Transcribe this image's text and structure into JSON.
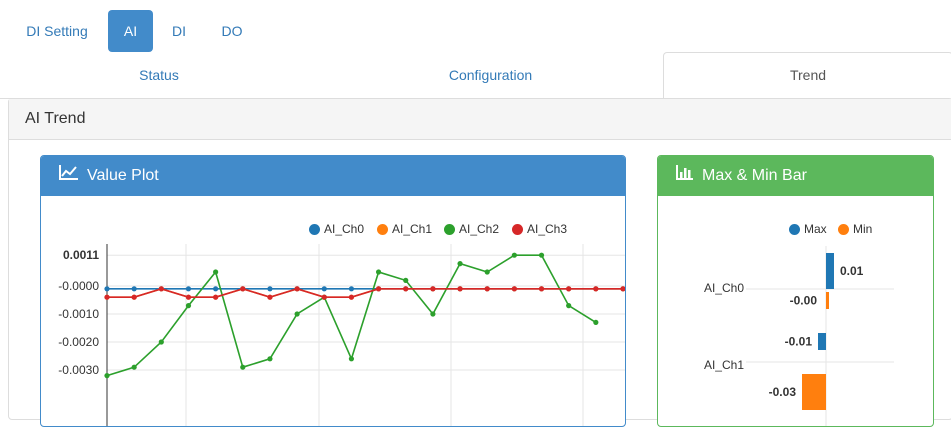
{
  "nav": {
    "pills": [
      {
        "label": "DI Setting",
        "active": false
      },
      {
        "label": "AI",
        "active": true
      },
      {
        "label": "DI",
        "active": false
      },
      {
        "label": "DO",
        "active": false
      }
    ]
  },
  "tabs": [
    {
      "label": "Status",
      "active": false
    },
    {
      "label": "Configuration",
      "active": false
    },
    {
      "label": "Trend",
      "active": true
    }
  ],
  "panel": {
    "title": "AI Trend"
  },
  "value_plot": {
    "title": "Value Plot",
    "icon": "line-chart-icon",
    "header_color": "#428bca"
  },
  "max_min": {
    "title": "Max & Min Bar",
    "icon": "bar-chart-icon",
    "header_color": "#5cb85c"
  },
  "chart_data": [
    {
      "type": "line",
      "ytick_labels": [
        "0.0011",
        "-0.0000",
        "-0.0010",
        "-0.0020",
        "-0.0030"
      ],
      "ylim": [
        -0.0033,
        0.0011
      ],
      "grid": true,
      "legend_position": "top-right",
      "series": [
        {
          "name": "AI_Ch0",
          "color": "#1f77b4",
          "values": [
            -0.0001,
            -0.0001,
            -0.0001,
            -0.0001,
            -0.0001,
            -0.0001,
            -0.0001,
            -0.0001,
            -0.0001,
            -0.0001,
            -0.0001,
            -0.0001,
            -0.0001,
            -0.0001,
            -0.0001,
            -0.0001,
            -0.0001,
            -0.0001,
            -0.0001,
            -0.0001
          ]
        },
        {
          "name": "AI_Ch1",
          "color": "#ff7f0e",
          "values": [
            -0.0004,
            -0.0004,
            -0.0001,
            -0.0004,
            -0.0004,
            -0.0001,
            -0.0004,
            -0.0001,
            -0.0004,
            -0.0004,
            -0.0001,
            -0.0001,
            -0.0001,
            -0.0001,
            -0.0001,
            -0.0001,
            -0.0001,
            -0.0001,
            -0.0001,
            -0.0001
          ]
        },
        {
          "name": "AI_Ch2",
          "color": "#2ca02c",
          "values": [
            -0.0032,
            -0.0029,
            -0.002,
            -0.0007,
            0.0005,
            -0.0029,
            -0.0026,
            -0.001,
            -0.0004,
            -0.0026,
            0.0005,
            0.0002,
            -0.001,
            0.0008,
            0.0005,
            0.0011,
            0.0011,
            -0.0007,
            -0.0013
          ]
        },
        {
          "name": "AI_Ch3",
          "color": "#d62728",
          "values": [
            -0.0004,
            -0.0004,
            -0.0001,
            -0.0004,
            -0.0004,
            -0.0001,
            -0.0004,
            -0.0001,
            -0.0004,
            -0.0004,
            -0.0001,
            -0.0001,
            -0.0001,
            -0.0001,
            -0.0001,
            -0.0001,
            -0.0001,
            -0.0001,
            -0.0001,
            -0.0001
          ]
        }
      ]
    },
    {
      "type": "bar",
      "legend_position": "top-right",
      "categories": [
        "AI_Ch0",
        "AI_Ch1"
      ],
      "series": [
        {
          "name": "Max",
          "color": "#1f77b4",
          "values": [
            0.01,
            -0.01
          ]
        },
        {
          "name": "Min",
          "color": "#ff7f0e",
          "values": [
            -0.0,
            -0.03
          ]
        }
      ],
      "value_labels": [
        [
          "0.01",
          "-0.01"
        ],
        [
          "-0.00",
          "-0.03"
        ]
      ]
    }
  ]
}
